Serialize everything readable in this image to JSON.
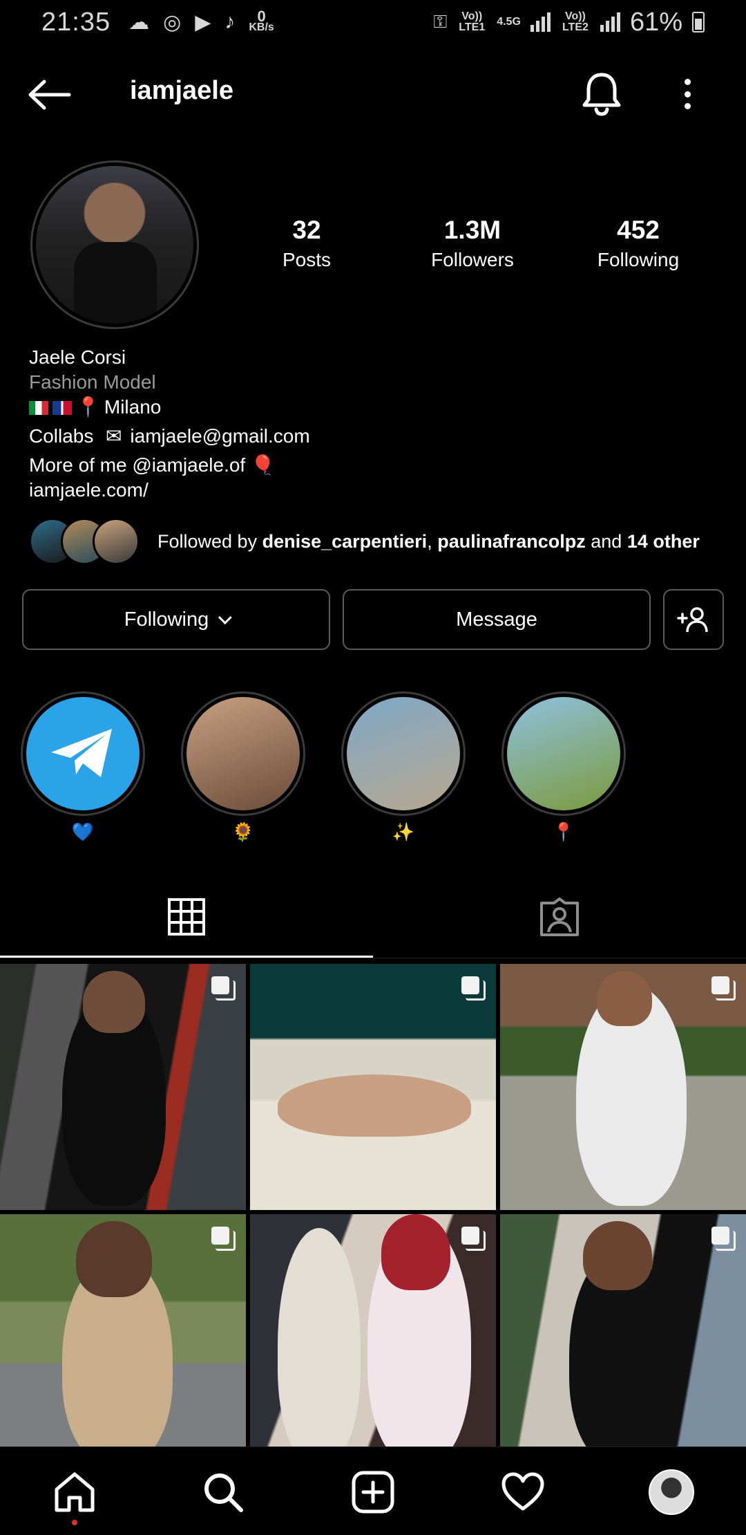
{
  "status_bar": {
    "time": "21:35",
    "data_speed_value": "0",
    "data_speed_unit": "KB/s",
    "sim1_label": "Vo)) LTE1",
    "network_type": "4.5G",
    "sim2_label": "Vo)) LTE2",
    "battery": "61%"
  },
  "header": {
    "username": "iamjaele"
  },
  "profile": {
    "posts_count": "32",
    "posts_label": "Posts",
    "followers_count": "1.3M",
    "followers_label": "Followers",
    "following_count": "452",
    "following_label": "Following"
  },
  "bio": {
    "full_name": "Jaele Corsi",
    "category": "Fashion Model",
    "location": "Milano",
    "collabs_label": "Collabs",
    "email": "iamjaele@gmail.com",
    "more_text": "More of me @iamjaele.of",
    "website": "iamjaele.com/"
  },
  "followed_by": {
    "prefix": "Followed by ",
    "user1": "denise_carpentieri",
    "sep": ", ",
    "user2": "paulinafrancolpz",
    "and_text": " and ",
    "others": "14 other"
  },
  "actions": {
    "following_label": "Following",
    "message_label": "Message"
  },
  "highlights": [
    {
      "label": "💙"
    },
    {
      "label": "🌻"
    },
    {
      "label": "✨"
    },
    {
      "label": "📍"
    }
  ],
  "tabs": {
    "active": "grid"
  },
  "colors": {
    "background": "#000000",
    "text_primary": "#ffffff",
    "text_secondary": "#9a9a9a",
    "border": "#5b5b5b",
    "telegram_blue": "#2aa3e8",
    "notification_dot": "#e0302f"
  }
}
